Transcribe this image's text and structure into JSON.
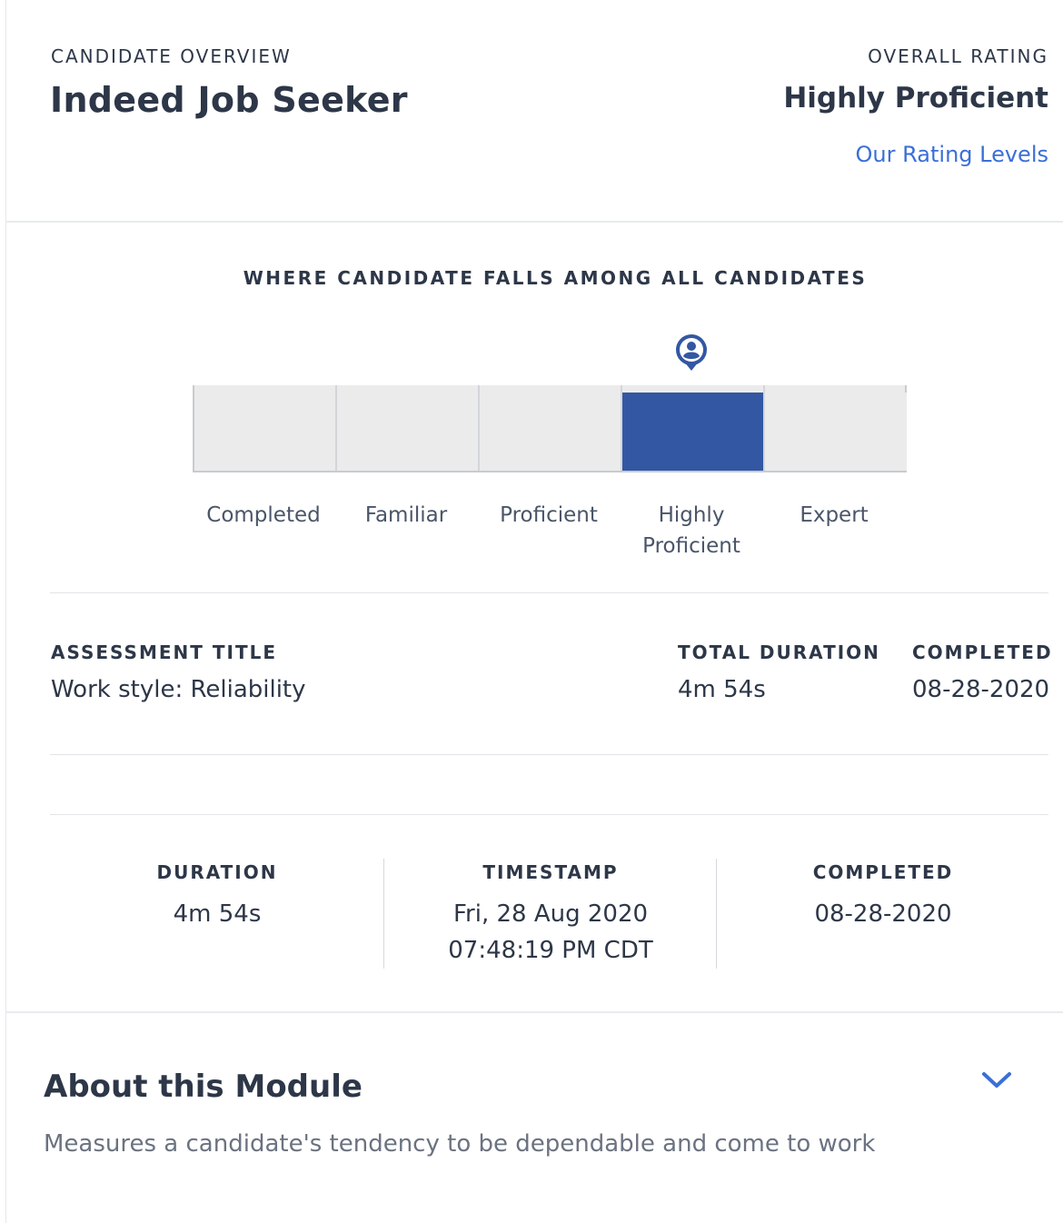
{
  "header": {
    "candidate_label": "CANDIDATE OVERVIEW",
    "candidate_name": "Indeed Job Seeker",
    "rating_label": "OVERALL RATING",
    "rating_value": "Highly Proficient",
    "rating_link": "Our Rating Levels"
  },
  "chart": {
    "title": "WHERE CANDIDATE FALLS AMONG ALL CANDIDATES",
    "levels": [
      "Completed",
      "Familiar",
      "Proficient",
      "Highly Proficient",
      "Expert"
    ],
    "label_lines": [
      [
        "Completed"
      ],
      [
        "Familiar"
      ],
      [
        "Proficient"
      ],
      [
        "Highly",
        "Proficient"
      ],
      [
        "Expert"
      ]
    ],
    "active_level": "Highly Proficient",
    "active_color": "#3357a2",
    "marker_icon": "user-location-pin-icon"
  },
  "assessment": {
    "title_label": "ASSESSMENT TITLE",
    "title_value": "Work style: Reliability",
    "duration_label": "TOTAL DURATION",
    "duration_value": "4m 54s",
    "completed_label": "COMPLETED",
    "completed_value": "08-28-2020"
  },
  "stats": {
    "duration_label": "DURATION",
    "duration_value": "4m 54s",
    "timestamp_label": "TIMESTAMP",
    "timestamp_line1": "Fri, 28 Aug 2020",
    "timestamp_line2": "07:48:19 PM CDT",
    "completed_label": "COMPLETED",
    "completed_value": "08-28-2020"
  },
  "about": {
    "title": "About this Module",
    "description": "Measures a candidate's tendency to be dependable and come to work",
    "toggle_icon": "chevron-down-icon",
    "accent_color": "#3a6fd8"
  }
}
